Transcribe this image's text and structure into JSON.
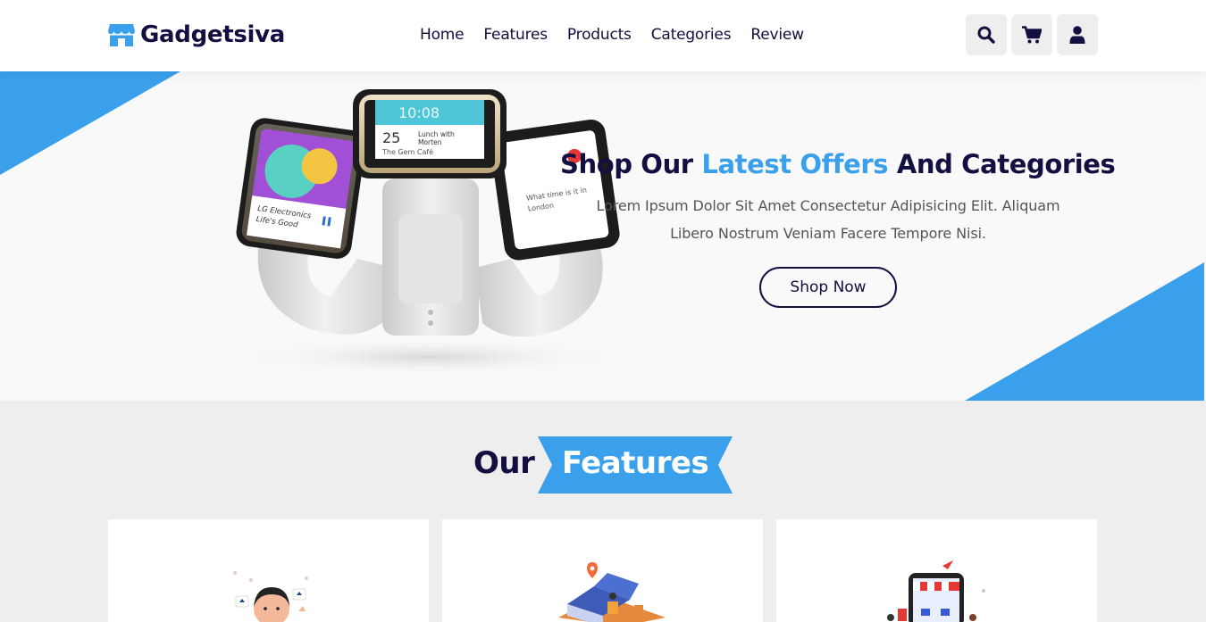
{
  "brand": {
    "name": "Gadgetsiva",
    "icon": "store-icon",
    "accent_color": "#3aa0ec",
    "dark_color": "#130f40"
  },
  "nav": {
    "items": [
      "Home",
      "Features",
      "Products",
      "Categories",
      "Review"
    ]
  },
  "header_icons": [
    "search-icon",
    "cart-icon",
    "user-icon"
  ],
  "hero": {
    "title_start": "Shop Our ",
    "title_accent": "Latest Offers",
    "title_end": " And Categories",
    "description": "Lorem Ipsum Dolor Sit Amet Consectetur Adipisicing Elit. Aliquam Libero Nostrum Veniam Facere Tempore Nisi.",
    "button_label": "Shop Now",
    "image": "smartwatch-product-image",
    "watch_screens": {
      "left_line1": "LG Electronics",
      "left_line2": "Life's Good",
      "center_time": "10:08",
      "center_day": "25",
      "center_line1": "Lunch with",
      "center_line2": "Morten",
      "center_line3": "The Gem Café",
      "right_line1": "What time is it in",
      "right_line2": "London"
    }
  },
  "features": {
    "heading_plain": "Our",
    "heading_accent": "Features",
    "cards": [
      {
        "illustration": "customer-review-illustration"
      },
      {
        "illustration": "delivery-illustration"
      },
      {
        "illustration": "online-shop-illustration"
      }
    ]
  }
}
